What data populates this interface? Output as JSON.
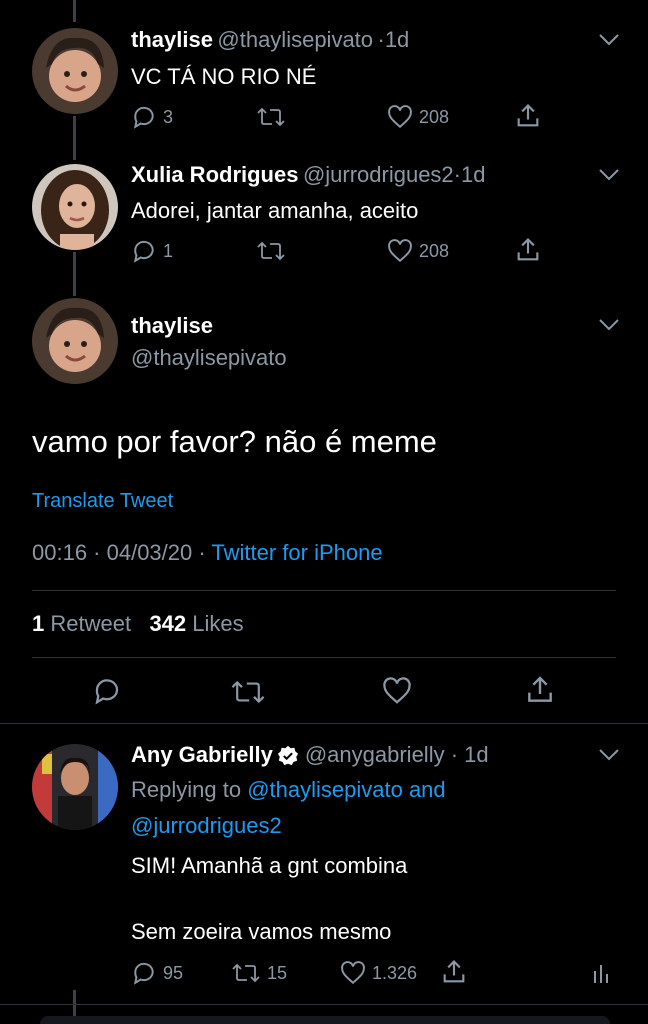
{
  "tweets": [
    {
      "name": "thaylise",
      "handle": "@thaylisepivato",
      "time": "1d",
      "text": "VC TÁ NO RIO NÉ",
      "replies": "3",
      "likes": "208"
    },
    {
      "name": "Xulia Rodrigues",
      "handle": "@jurrodrigues2",
      "time": "1d",
      "text": "Adorei, jantar amanha, aceito",
      "replies": "1",
      "likes": "208"
    }
  ],
  "main": {
    "name": "thaylise",
    "handle": "@thaylisepivato",
    "text": "vamo por favor? não é meme",
    "translate": "Translate Tweet",
    "timestamp": "00:16 · 04/03/20 ·",
    "source": "Twitter for iPhone",
    "retweets_count": "1",
    "retweets_label": "Retweet",
    "likes_count": "342",
    "likes_label": "Likes"
  },
  "reply": {
    "name": "Any Gabrielly",
    "handle": "@anygabrielly",
    "time": "1d",
    "replying_prefix": "Replying to",
    "replying_users_1": "@thaylisepivato and",
    "replying_users_2": "@jurrodrigues2",
    "line1": "SIM! Amanhã a gnt combina",
    "line2": "Sem zoeira vamos mesmo",
    "replies": "95",
    "retweets": "15",
    "likes": "1.326"
  },
  "colors": {
    "background": "#000000",
    "muted": "#8b98a5",
    "link": "#1d9bf0",
    "verified": "#ffffff"
  }
}
